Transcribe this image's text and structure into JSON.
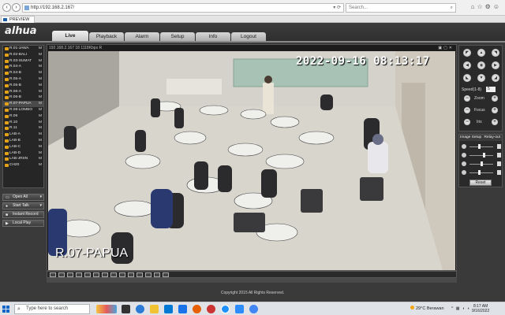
{
  "browser": {
    "url": "http://192.168.2.167/",
    "search_placeholder": "Search...",
    "tab_title": "PREVIEW"
  },
  "app": {
    "logo": "alhua",
    "nav": [
      {
        "label": "Live",
        "active": true
      },
      {
        "label": "Playback"
      },
      {
        "label": "Alarm"
      },
      {
        "label": "Setup"
      },
      {
        "label": "Info"
      },
      {
        "label": "Logout"
      }
    ]
  },
  "channels": [
    {
      "label": "R.01-JAWA",
      "flag": "M"
    },
    {
      "label": "R.02-BALI",
      "flag": "M"
    },
    {
      "label": "R.03-SUMAT",
      "flag": "M"
    },
    {
      "label": "R.04-A",
      "flag": "M"
    },
    {
      "label": "R.04-B",
      "flag": "M"
    },
    {
      "label": "R.05-A",
      "flag": "M"
    },
    {
      "label": "R.05-B",
      "flag": "M"
    },
    {
      "label": "R.06-A",
      "flag": "M"
    },
    {
      "label": "R.06-B",
      "flag": "M"
    },
    {
      "label": "R.07-PAPUA",
      "flag": "M",
      "selected": true
    },
    {
      "label": "R.08-LOMBO",
      "flag": "M"
    },
    {
      "label": "R.09",
      "flag": "M"
    },
    {
      "label": "R.10",
      "flag": "M"
    },
    {
      "label": "R.11",
      "flag": "M"
    },
    {
      "label": "LAB-A",
      "flag": "M"
    },
    {
      "label": "LAB-B",
      "flag": "M"
    },
    {
      "label": "LAB-C",
      "flag": "M"
    },
    {
      "label": "LAB-D",
      "flag": "M"
    },
    {
      "label": "LAB-JRSN",
      "flag": "M"
    },
    {
      "label": "CH20",
      "flag": "M"
    }
  ],
  "left_buttons": {
    "open_all": "Open All",
    "start_talk": "Start Talk",
    "instant_record": "Instant Record",
    "local_play": "Local Play"
  },
  "video": {
    "title": "192.168.2.167 18 1118Kbps R",
    "osd_time": "2022-09-16  08:13:17",
    "osd_name": "R.07-PAPUA"
  },
  "ptz": {
    "speed_label": "Speed(1-8)",
    "speed_value": "5",
    "zoom_label": "Zoom",
    "focus_label": "Focus",
    "iris_label": "Iris"
  },
  "image_setup": {
    "title": "Image Setup",
    "relay_out": "Relay-out",
    "reset_label": "Reset",
    "levels": [
      0.4,
      0.6,
      0.5,
      0.4
    ]
  },
  "footer": {
    "copyright": "Copyright 2015 All Rights Reserved."
  },
  "taskbar": {
    "search_placeholder": "Type here to search",
    "temperature": "29°C",
    "weather": "Berawan",
    "time": "8:17 AM",
    "date": "9/16/2022"
  }
}
